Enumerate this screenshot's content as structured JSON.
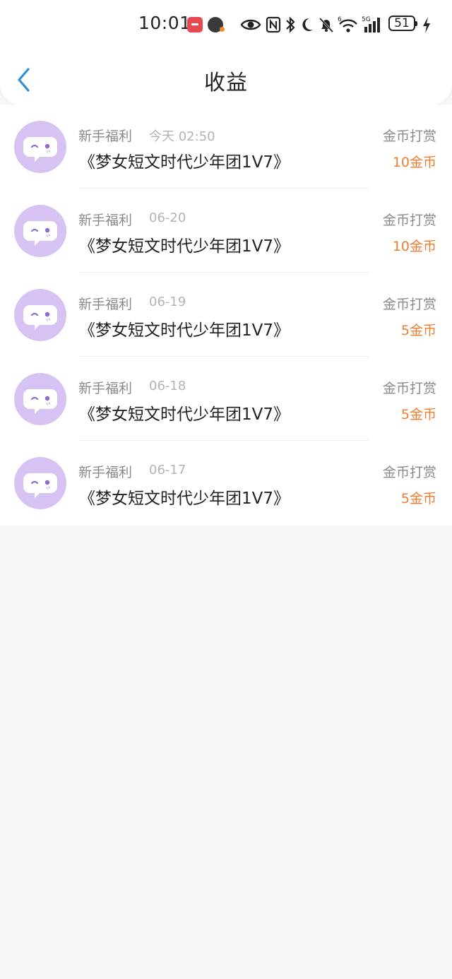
{
  "status_bar": {
    "time": "10:01",
    "battery": "51"
  },
  "header": {
    "title": "收益",
    "back_icon": "chevron-left-icon"
  },
  "colors": {
    "accent": "#2f8fd8",
    "amount": "#ef7d2f",
    "avatar_bg": "#d6c3f4",
    "avatar_icon": "#8f6ad1"
  },
  "records": [
    {
      "source": "新手福利",
      "time": "今天 02:50",
      "title": "《梦女短文时代少年团1V7》",
      "type": "金币打赏",
      "amount": "10金币"
    },
    {
      "source": "新手福利",
      "time": "06-20",
      "title": "《梦女短文时代少年团1V7》",
      "type": "金币打赏",
      "amount": "10金币"
    },
    {
      "source": "新手福利",
      "time": "06-19",
      "title": "《梦女短文时代少年团1V7》",
      "type": "金币打赏",
      "amount": "5金币"
    },
    {
      "source": "新手福利",
      "time": "06-18",
      "title": "《梦女短文时代少年团1V7》",
      "type": "金币打赏",
      "amount": "5金币"
    },
    {
      "source": "新手福利",
      "time": "06-17",
      "title": "《梦女短文时代少年团1V7》",
      "type": "金币打赏",
      "amount": "5金币"
    }
  ]
}
